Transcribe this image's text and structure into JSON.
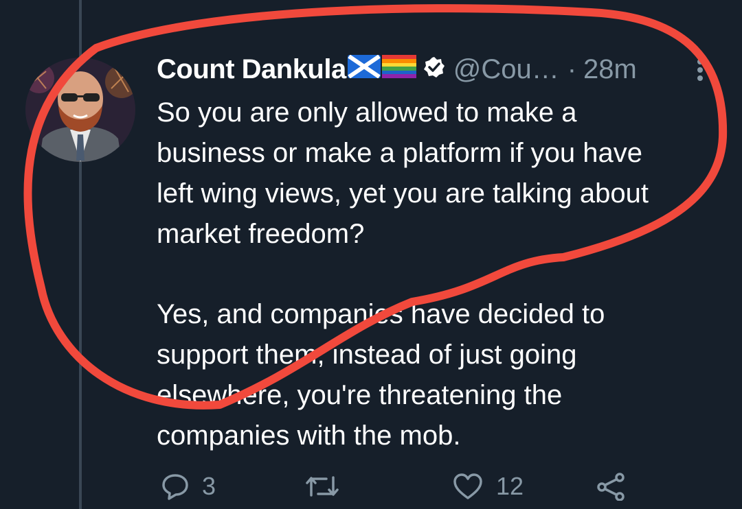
{
  "tweet": {
    "author_name": "Count Dankula",
    "flags": [
      "scotland-flag-icon",
      "rainbow-flag-icon"
    ],
    "verified": true,
    "handle": "@Cou…",
    "separator": "·",
    "time": "28m",
    "paragraph_1": [
      "So you are only allowed to make a",
      "business or make a platform if you have",
      "left wing views, yet you are talking about",
      "market freedom?"
    ],
    "paragraph_2": [
      "Yes, and companies have decided to",
      "support them, instead of just going",
      "elsewhere, you're threatening the",
      "companies with the mob."
    ],
    "replies": "3",
    "retweets": "",
    "likes": "12"
  },
  "colors": {
    "background": "#161f2a",
    "muted": "#8899a6",
    "annotation": "#f1493c"
  }
}
